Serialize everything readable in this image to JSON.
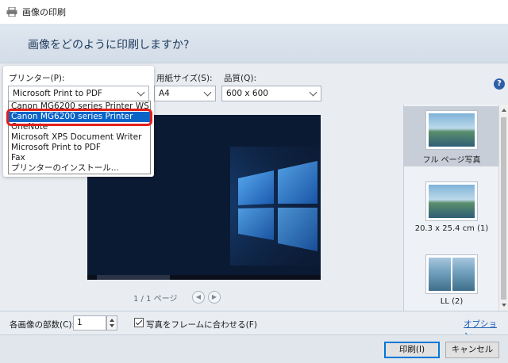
{
  "window": {
    "title": "画像の印刷"
  },
  "header": {
    "question": "画像をどのように印刷しますか?"
  },
  "printer": {
    "label": "プリンター(P):",
    "selected": "Microsoft Print to PDF",
    "options": [
      "Canon MG6200 series Printer WS",
      "Canon MG6200 series Printer",
      "OneNote",
      "Microsoft XPS Document Writer",
      "Microsoft Print to PDF",
      "Fax",
      "プリンターのインストール..."
    ],
    "highlighted": "Canon MG6200 series Printer"
  },
  "paper": {
    "label": "用紙サイズ(S):",
    "value": "A4"
  },
  "quality": {
    "label": "品質(Q):",
    "value": "600 x 600"
  },
  "help": {
    "glyph": "?"
  },
  "pager": {
    "text": "1 / 1 ページ",
    "prev": "◀",
    "next": "▶"
  },
  "layouts": [
    {
      "caption": "フル ページ写真",
      "selected": true,
      "icon": "landscape-photo"
    },
    {
      "caption": "20.3 x 25.4 cm (1)",
      "selected": false,
      "icon": "landscape-photo"
    },
    {
      "caption": "LL (2)",
      "selected": false,
      "icon": "two-photos"
    }
  ],
  "copies": {
    "label": "各画像の部数(C):",
    "value": "1"
  },
  "fit": {
    "label": "写真をフレームに合わせる(F)",
    "checked": true
  },
  "options_link": "オプション...",
  "buttons": {
    "print": "印刷(I)",
    "cancel": "キャンセル"
  },
  "colors": {
    "accent": "#0a64c8",
    "highlight_ring": "#e0201c",
    "header_text": "#1e3a5c"
  }
}
